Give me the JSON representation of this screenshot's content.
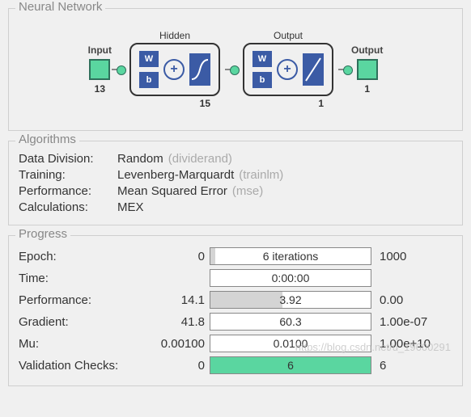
{
  "groups": {
    "nn": "Neural Network",
    "alg": "Algorithms",
    "prog": "Progress"
  },
  "nn": {
    "input": {
      "label": "Input",
      "count": "13"
    },
    "hidden": {
      "label": "Hidden",
      "count": "15",
      "w": "W",
      "b": "b"
    },
    "output_layer": {
      "label": "Output",
      "count": "1",
      "w": "W",
      "b": "b"
    },
    "output": {
      "label": "Output",
      "count": "1"
    },
    "sum": "+"
  },
  "algorithms": [
    {
      "label": "Data Division:",
      "value": "Random",
      "note": "(dividerand)"
    },
    {
      "label": "Training:",
      "value": "Levenberg-Marquardt",
      "note": "(trainlm)"
    },
    {
      "label": "Performance:",
      "value": "Mean Squared Error",
      "note": "(mse)"
    },
    {
      "label": "Calculations:",
      "value": "MEX",
      "note": ""
    }
  ],
  "progress": [
    {
      "label": "Epoch:",
      "start": "0",
      "text": "6 iterations",
      "end": "1000",
      "fill": 3,
      "green": false
    },
    {
      "label": "Time:",
      "start": "",
      "text": "0:00:00",
      "end": "",
      "fill": 0,
      "green": false
    },
    {
      "label": "Performance:",
      "start": "14.1",
      "text": "3.92",
      "end": "0.00",
      "fill": 45,
      "green": false
    },
    {
      "label": "Gradient:",
      "start": "41.8",
      "text": "60.3",
      "end": "1.00e-07",
      "fill": 0,
      "green": false
    },
    {
      "label": "Mu:",
      "start": "0.00100",
      "text": "0.0100",
      "end": "1.00e+10",
      "fill": 0,
      "green": false
    },
    {
      "label": "Validation Checks:",
      "start": "0",
      "text": "6",
      "end": "6",
      "fill": 100,
      "green": true
    }
  ],
  "watermark": "https://blog.csdn.net/u_19600291"
}
